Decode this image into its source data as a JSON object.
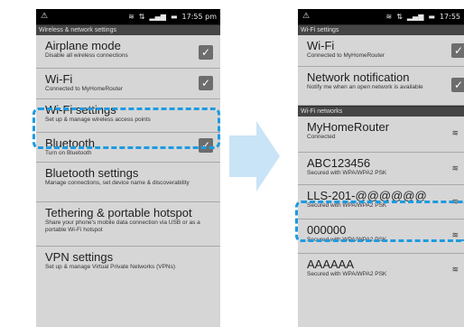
{
  "left_phone": {
    "status": {
      "alert_icon": "warning-icon",
      "time": "17:55 pm"
    },
    "section_title": "Wireless & network settings",
    "items": [
      {
        "title": "Airplane mode",
        "subtitle": "Disable all wireless connections",
        "checked": true
      },
      {
        "title": "Wi-Fi",
        "subtitle": "Connected to MyHomeRouter",
        "checked": true
      },
      {
        "title": "Wi-Fi settings",
        "subtitle": "Set up & manage wireless access points"
      },
      {
        "title": "Bluetooth",
        "subtitle": "Turn on Bluetooth",
        "checked": true
      },
      {
        "title": "Bluetooth settings",
        "subtitle": "Manage connections, set device name & discoverability"
      },
      {
        "title": "Tethering & portable hotspot",
        "subtitle": "Share your phone's mobile data connection via USB or as a portable Wi-Fi hotspot"
      },
      {
        "title": "VPN settings",
        "subtitle": "Set up & manage Virtual Private Networks (VPNs)"
      }
    ]
  },
  "right_phone": {
    "status": {
      "alert_icon": "warning-icon",
      "time": "17:55"
    },
    "section_title": "Wi-Fi settings",
    "items": [
      {
        "title": "Wi-Fi",
        "subtitle": "Connected to MyHomeRouter",
        "checked": true
      },
      {
        "title": "Network notification",
        "subtitle": "Notify me when an open network is available",
        "checked": true
      }
    ],
    "networks_header": "Wi-Fi networks",
    "networks": [
      {
        "name": "MyHomeRouter",
        "status": "Connected"
      },
      {
        "name": "ABC123456",
        "status": "Secured with WPA/WPA2 PSK"
      },
      {
        "name": "LLS-201-@@@@@@",
        "status": "Secured with WPA/WPA2 PSK"
      },
      {
        "name": "000000",
        "status": "Secured with WPA/WPA2 PSK"
      },
      {
        "name": "AAAAAA",
        "status": "Secured with WPA/WPA2 PSK"
      }
    ]
  },
  "colors": {
    "highlight": "#1e9be0",
    "arrow": "#c9e4f6"
  }
}
